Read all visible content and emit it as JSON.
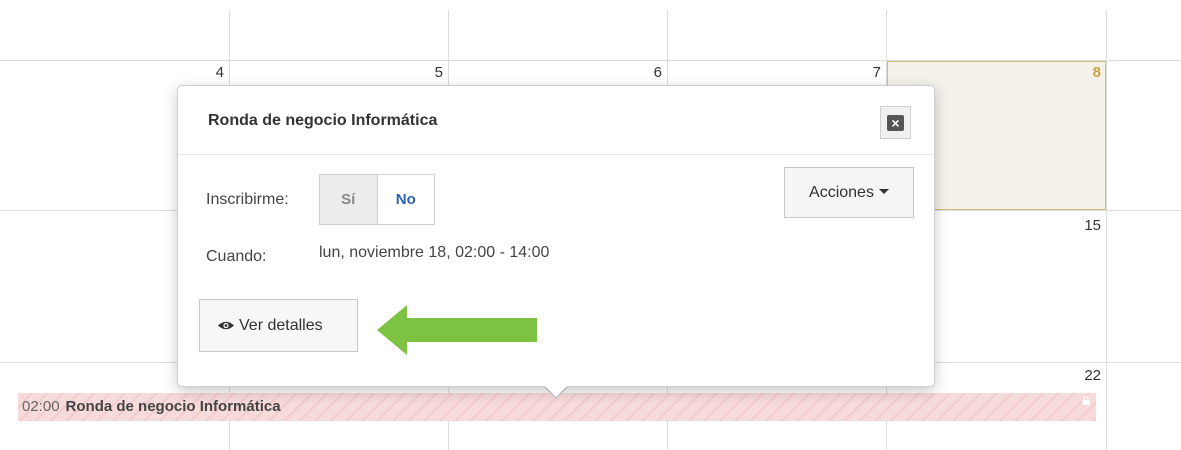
{
  "calendar": {
    "day_numbers": [
      "4",
      "5",
      "6",
      "7",
      "8",
      "15",
      "22"
    ],
    "today": "8",
    "colors": {
      "today_bg": "#f3f1ea",
      "today_border": "#d5bd79",
      "event_stripe": "#f7dada"
    }
  },
  "event_bar": {
    "time": "02:00",
    "title": "Ronda de negocio Informática",
    "lock_icon": "lock-icon"
  },
  "popover": {
    "title": "Ronda de negocio Informática",
    "close_icon": "close-icon",
    "enroll_label": "Inscribirme:",
    "enroll_options": [
      "Sí",
      "No"
    ],
    "enroll_selected": "No",
    "when_label": "Cuando:",
    "when_value": "lun, noviembre 18, 02:00 - 14:00",
    "actions_label": "Acciones",
    "details_label": "Ver detalles",
    "details_icon": "eye-icon",
    "colors": {
      "selected_option": "#2a60b5",
      "annotation_arrow": "#7dc242"
    }
  }
}
